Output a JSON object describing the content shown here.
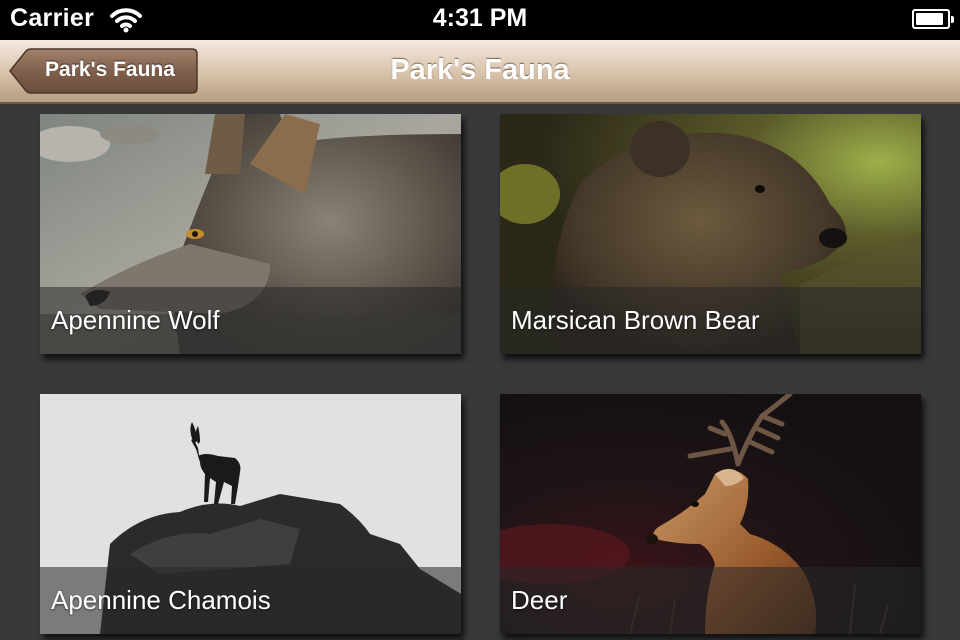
{
  "status_bar": {
    "carrier": "Carrier",
    "time": "4:31 PM",
    "battery_level": 0.9
  },
  "nav_bar": {
    "title": "Park's Fauna",
    "back_label": "Park's Fauna"
  },
  "animals": [
    {
      "name": "Apennine Wolf"
    },
    {
      "name": "Marsican Brown Bear"
    },
    {
      "name": "Apennine Chamois"
    },
    {
      "name": "Deer"
    }
  ],
  "colors": {
    "background": "#39393b",
    "nav_bar_light": "#f3e9de",
    "nav_bar_dark": "#b79c80",
    "back_button": "#7d5f4b"
  }
}
